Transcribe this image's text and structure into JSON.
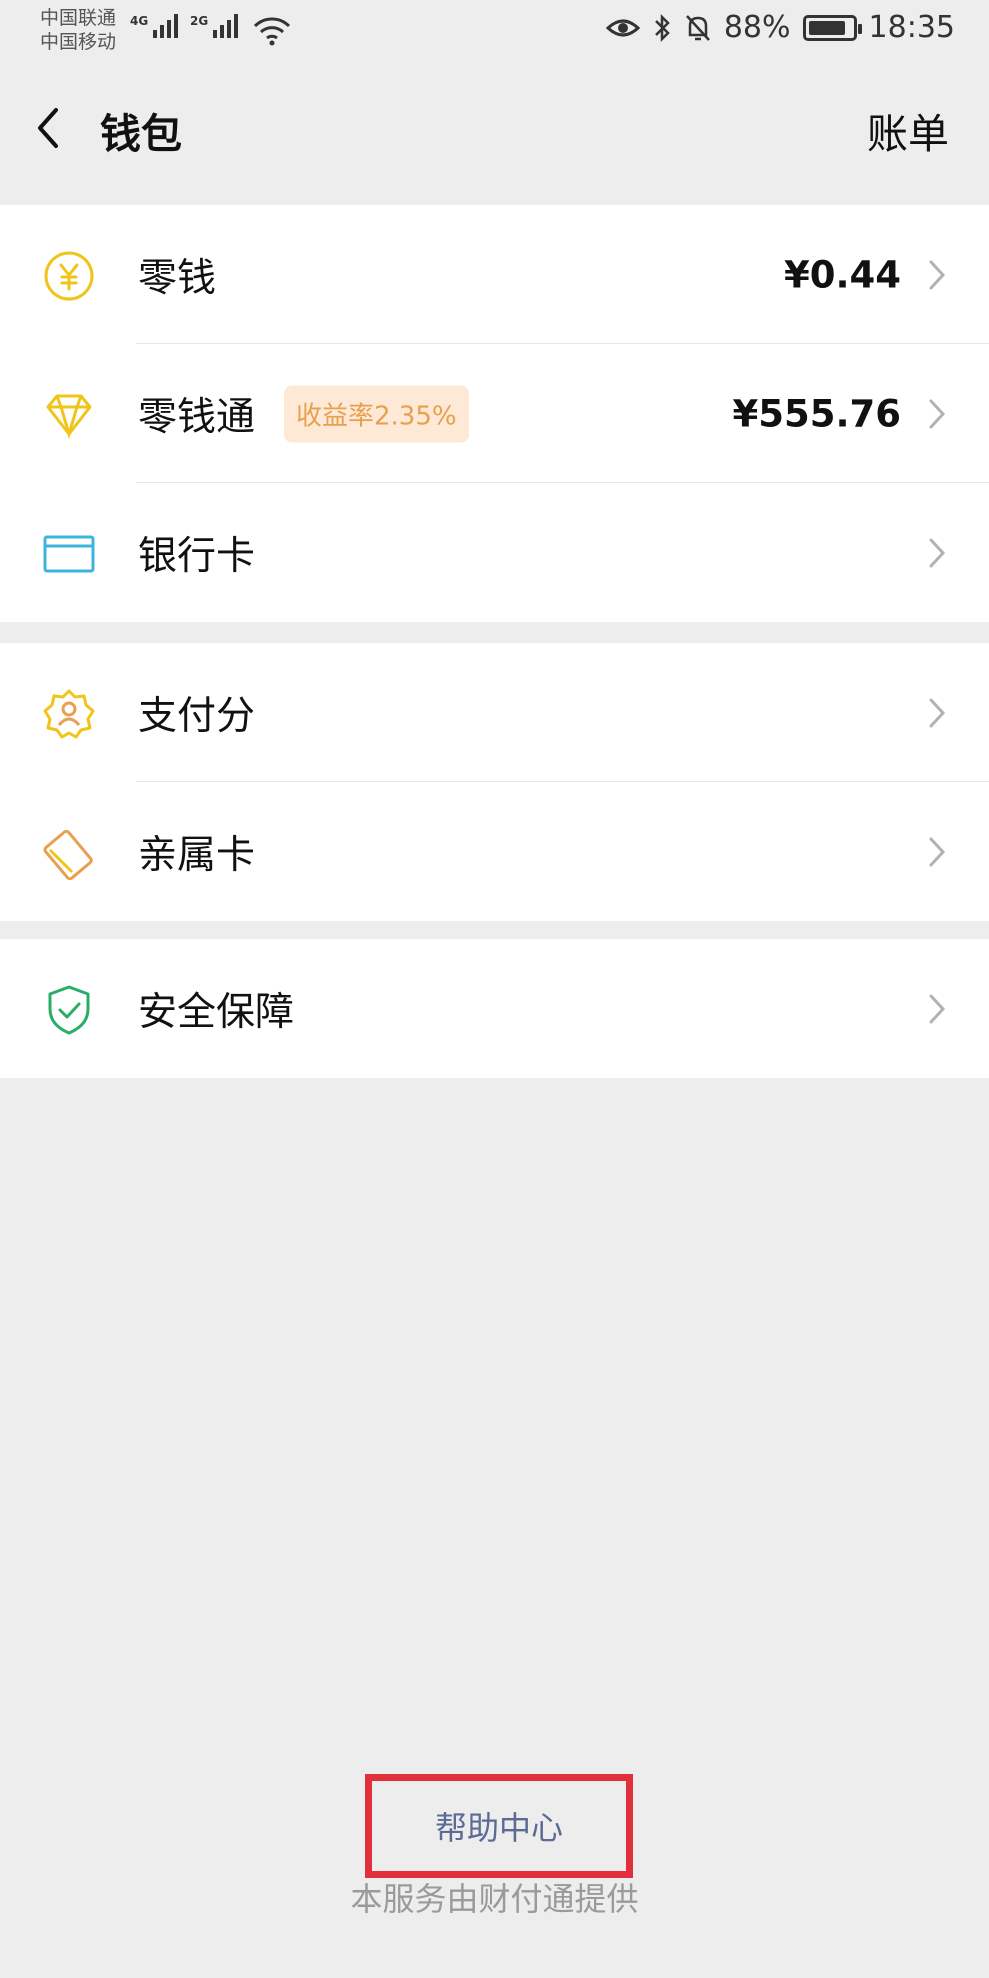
{
  "status_bar": {
    "carrier_1": "中国联通",
    "carrier_2": "中国移动",
    "network_1": "4G",
    "network_2": "2G",
    "battery": "88%",
    "time": "18:35"
  },
  "nav": {
    "title": "钱包",
    "action": "账单"
  },
  "groups": [
    {
      "items": [
        {
          "label": "零钱",
          "value": "¥0.44",
          "icon": "yuan-coin-icon"
        },
        {
          "label": "零钱通",
          "badge": "收益率2.35%",
          "value": "¥555.76",
          "icon": "diamond-icon"
        },
        {
          "label": "银行卡",
          "icon": "bank-card-icon"
        }
      ]
    },
    {
      "items": [
        {
          "label": "支付分",
          "icon": "payment-score-icon"
        },
        {
          "label": "亲属卡",
          "icon": "family-card-icon"
        }
      ]
    },
    {
      "items": [
        {
          "label": "安全保障",
          "icon": "shield-check-icon"
        }
      ]
    }
  ],
  "footer": {
    "help": "帮助中心",
    "provider": "本服务由财付通提供"
  },
  "colors": {
    "background": "#ededed",
    "icon_yellow": "#f0c419",
    "icon_blue": "#3cb4dc",
    "icon_orange": "#e8a050",
    "icon_green": "#2aae67",
    "highlight_red": "#e1303c",
    "link": "#5b6b93"
  }
}
